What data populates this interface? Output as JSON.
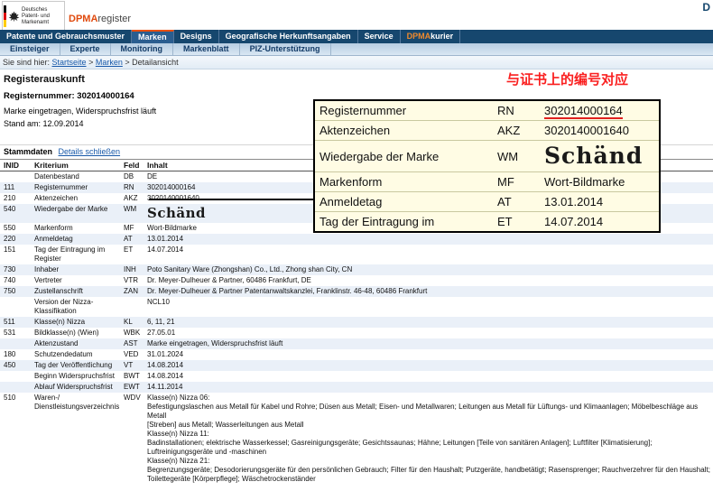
{
  "header": {
    "logo_line1": "Deutsches",
    "logo_line2": "Patent- und Markenamt",
    "brand_dpma": "DPMA",
    "brand_register": "register",
    "top_right": "D"
  },
  "nav": {
    "primary": [
      {
        "label": "Patente und Gebrauchsmuster",
        "active": false
      },
      {
        "label": "Marken",
        "active": true
      },
      {
        "label": "Designs",
        "active": false
      },
      {
        "label": "Geografische Herkunftsangaben",
        "active": false
      },
      {
        "label": "Service",
        "active": false
      },
      {
        "label": "DPMAkurier",
        "active": false,
        "accent_prefix": "DPMA",
        "suffix": "kurier"
      }
    ],
    "secondary": [
      "Einsteiger",
      "Experte",
      "Monitoring",
      "Markenblatt",
      "PIZ-Unterstützung"
    ]
  },
  "breadcrumb": {
    "prefix": "Sie sind hier: ",
    "items": [
      {
        "label": "Startseite",
        "link": true
      },
      {
        "label": "Marken",
        "link": true
      },
      {
        "label": "Detailansicht",
        "link": false
      }
    ]
  },
  "summary": {
    "title": "Registerauskunft",
    "registernummer_line": "Registernummer: 302014000164",
    "status_line": "Marke eingetragen, Widerspruchsfrist läuft",
    "stand_line": "Stand am: 12.09.2014"
  },
  "annotation": {
    "text": "与证书上的编号对应",
    "color": "#fa2020"
  },
  "callout": {
    "rows": [
      {
        "label": "Registernummer",
        "code": "RN",
        "value": "302014000164",
        "underline": true
      },
      {
        "label": "Aktenzeichen",
        "code": "AKZ",
        "value": "3020140001640"
      },
      {
        "label": "Wiedergabe der Marke",
        "code": "WM",
        "value": "Schänd",
        "mark": true
      },
      {
        "label": "Markenform",
        "code": "MF",
        "value": "Wort-Bildmarke"
      },
      {
        "label": "Anmeldetag",
        "code": "AT",
        "value": "13.01.2014"
      },
      {
        "label": "Tag der Eintragung im",
        "code": "ET",
        "value": "14.07.2014"
      }
    ]
  },
  "stammdaten": {
    "section_label": "Stammdaten",
    "details_link": "Details schließen",
    "columns": [
      "INID",
      "Kriterium",
      "Feld",
      "Inhalt"
    ],
    "rows": [
      {
        "inid": "",
        "kriterium": "Datenbestand",
        "feld": "DB",
        "inhalt": [
          "DE"
        ]
      },
      {
        "inid": "111",
        "kriterium": "Registernummer",
        "feld": "RN",
        "inhalt": [
          "302014000164"
        ]
      },
      {
        "inid": "210",
        "kriterium": "Aktenzeichen",
        "feld": "AKZ",
        "inhalt": [
          "3020140001640"
        ]
      },
      {
        "inid": "540",
        "kriterium": "Wiedergabe der Marke",
        "feld": "WM",
        "inhalt": [
          "Schänd"
        ],
        "mark": true
      },
      {
        "inid": "550",
        "kriterium": "Markenform",
        "feld": "MF",
        "inhalt": [
          "Wort-Bildmarke"
        ]
      },
      {
        "inid": "220",
        "kriterium": "Anmeldetag",
        "feld": "AT",
        "inhalt": [
          "13.01.2014"
        ]
      },
      {
        "inid": "151",
        "kriterium": "Tag der Eintragung im Register",
        "feld": "ET",
        "inhalt": [
          "14.07.2014"
        ]
      },
      {
        "inid": "730",
        "kriterium": "Inhaber",
        "feld": "INH",
        "inhalt": [
          "Poto Sanitary Ware (Zhongshan) Co., Ltd., Zhong shan City, CN"
        ]
      },
      {
        "inid": "740",
        "kriterium": "Vertreter",
        "feld": "VTR",
        "inhalt": [
          "Dr. Meyer-Dulheuer & Partner, 60486 Frankfurt, DE"
        ]
      },
      {
        "inid": "750",
        "kriterium": "Zustellanschrift",
        "feld": "ZAN",
        "inhalt": [
          "Dr. Meyer-Dulheuer & Partner Patentanwaltskanzlei, Franklinstr. 46-48, 60486 Frankfurt"
        ]
      },
      {
        "inid": "",
        "kriterium": "Version der Nizza-Klassifikation",
        "feld": "",
        "inhalt": [
          "NCL10"
        ]
      },
      {
        "inid": "511",
        "kriterium": "Klasse(n) Nizza",
        "feld": "KL",
        "inhalt": [
          "6, 11, 21"
        ]
      },
      {
        "inid": "531",
        "kriterium": "Bildklasse(n) (Wien)",
        "feld": "WBK",
        "inhalt": [
          "27.05.01"
        ]
      },
      {
        "inid": "",
        "kriterium": "Aktenzustand",
        "feld": "AST",
        "inhalt": [
          "Marke eingetragen, Widerspruchsfrist läuft"
        ]
      },
      {
        "inid": "180",
        "kriterium": "Schutzendedatum",
        "feld": "VED",
        "inhalt": [
          "31.01.2024"
        ]
      },
      {
        "inid": "450",
        "kriterium": "Tag der Veröffentlichung",
        "feld": "VT",
        "inhalt": [
          "14.08.2014"
        ]
      },
      {
        "inid": "",
        "kriterium": "Beginn Widerspruchsfrist",
        "feld": "BWT",
        "inhalt": [
          "14.08.2014"
        ]
      },
      {
        "inid": "",
        "kriterium": "Ablauf Widerspruchsfrist",
        "feld": "EWT",
        "inhalt": [
          "14.11.2014"
        ]
      },
      {
        "inid": "510",
        "kriterium": "Waren-/ Dienstleistungsverzeichnis",
        "feld": "WDV",
        "inhalt": [
          "Klasse(n) Nizza 06:",
          "Befestigungslaschen aus Metall für Kabel und Rohre; Düsen aus Metall; Eisen- und Metallwaren; Leitungen aus Metall für Lüftungs- und Klimaanlagen; Möbelbeschläge aus Metall",
          "[Streben] aus Metall; Wasserleitungen aus Metall",
          "Klasse(n) Nizza 11:",
          "Badinstallationen; elektrische Wasserkessel; Gasreinigungsgeräte; Gesichtssaunas; Hähne; Leitungen [Teile von sanitären Anlagen]; Luftfilter [Klimatisierung]; Luftreinigungsgeräte und -maschinen",
          "Klasse(n) Nizza 21:",
          "Begrenzungsgeräte; Desodorierungsgeräte für den persönlichen Gebrauch; Filter für den Haushalt; Putzgeräte, handbetätigt; Rasensprenger; Rauchverzehrer für den Haushalt;",
          "Toilettegeräte [Körperpflege]; Wäschetrockenständer"
        ]
      }
    ]
  }
}
